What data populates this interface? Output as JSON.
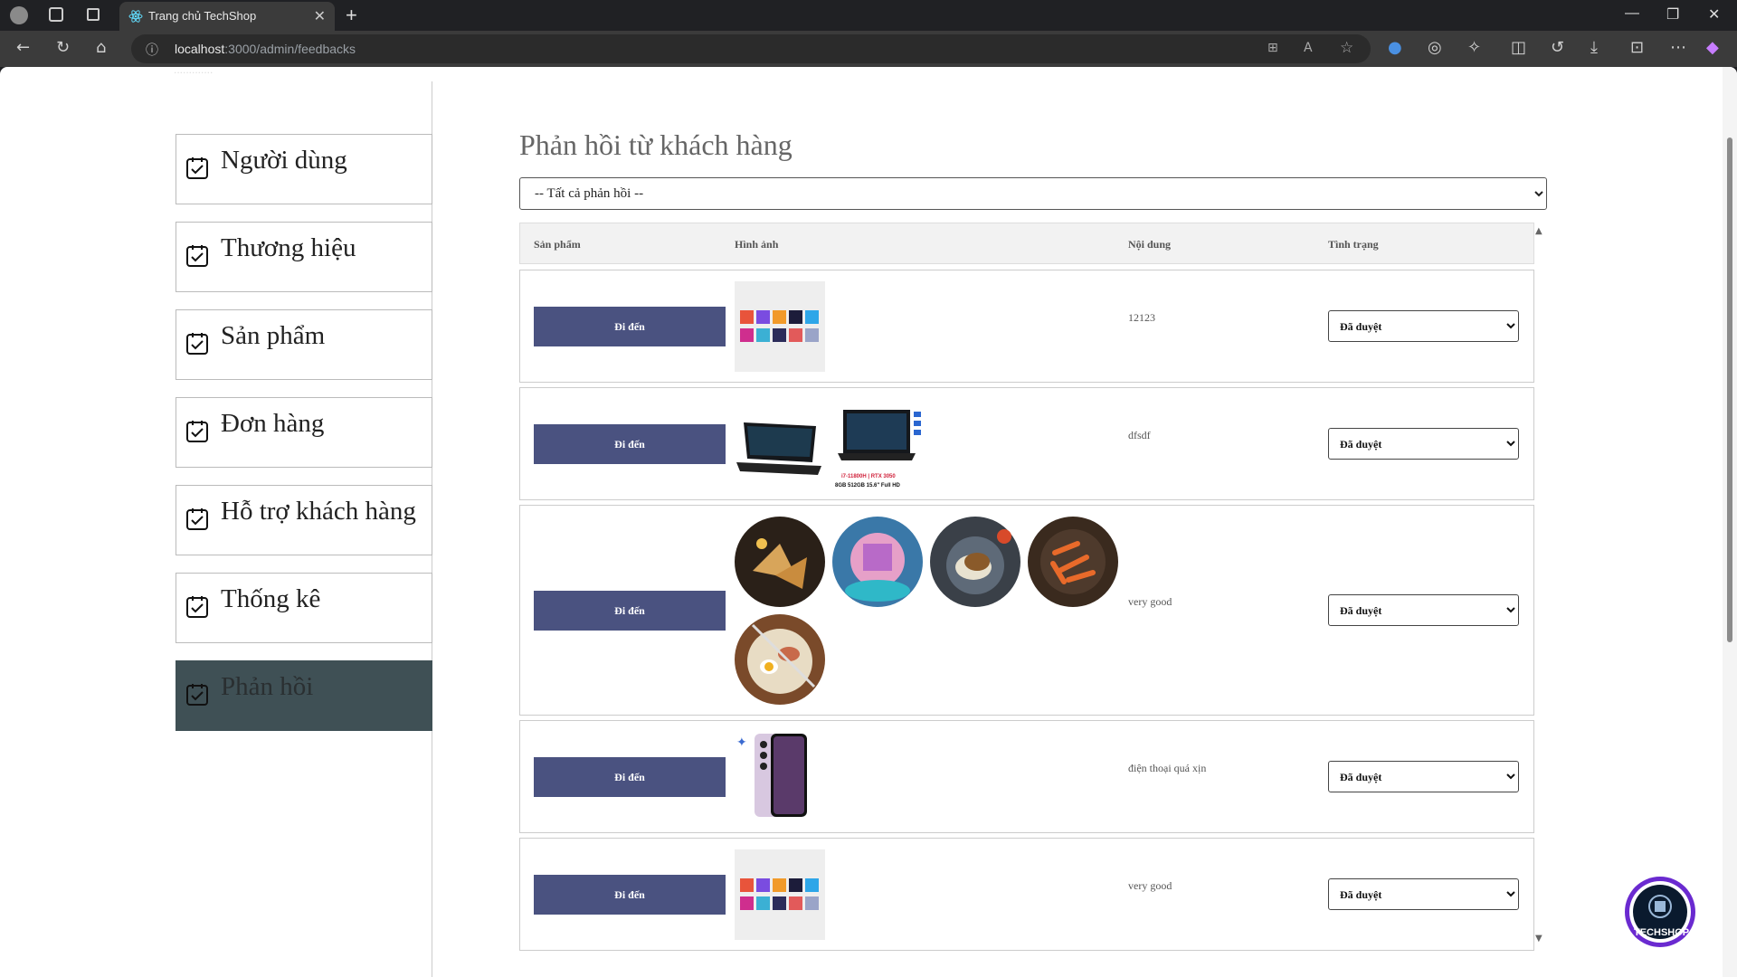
{
  "browser": {
    "tab_title": "Trang chủ TechShop",
    "url_host": "localhost",
    "url_rest": ":3000/admin/feedbacks"
  },
  "sidebar": {
    "items": [
      {
        "label": "Người dùng",
        "active": false
      },
      {
        "label": "Thương hiệu",
        "active": false
      },
      {
        "label": "Sản phẩm",
        "active": false
      },
      {
        "label": "Đơn hàng",
        "active": false
      },
      {
        "label": "Hỗ trợ khách hàng",
        "active": false
      },
      {
        "label": "Thống kê",
        "active": false
      },
      {
        "label": "Phản hồi",
        "active": true
      }
    ]
  },
  "main": {
    "title": "Phản hồi từ khách hàng",
    "filter_value": "-- Tất cả phản hồi --",
    "columns": [
      "Sản phẩm",
      "Hình ảnh",
      "Nội dung",
      "Tình trạng"
    ],
    "go_label": "Đi đến",
    "rows": [
      {
        "content": "12123",
        "status": "Đã duyệt",
        "images": [
          "gradient-grid"
        ]
      },
      {
        "content": "dfsdf",
        "status": "Đã duyệt",
        "images": [
          "laptop-1",
          "laptop-2"
        ]
      },
      {
        "content": "very good",
        "status": "Đã duyệt",
        "images": [
          "food-1",
          "food-2",
          "food-3",
          "food-4",
          "food-5"
        ]
      },
      {
        "content": "điện thoại quá xịn",
        "status": "Đã duyệt",
        "images": [
          "phone"
        ]
      },
      {
        "content": "very good",
        "status": "Đã duyệt",
        "images": [
          "gradient-grid"
        ]
      }
    ]
  },
  "laptop_caption": {
    "line1": "i7-11800H | RTX 3050",
    "line2": "8GB 512GB 15.6\" Full HD"
  },
  "logo_text": "TECHSHOP"
}
